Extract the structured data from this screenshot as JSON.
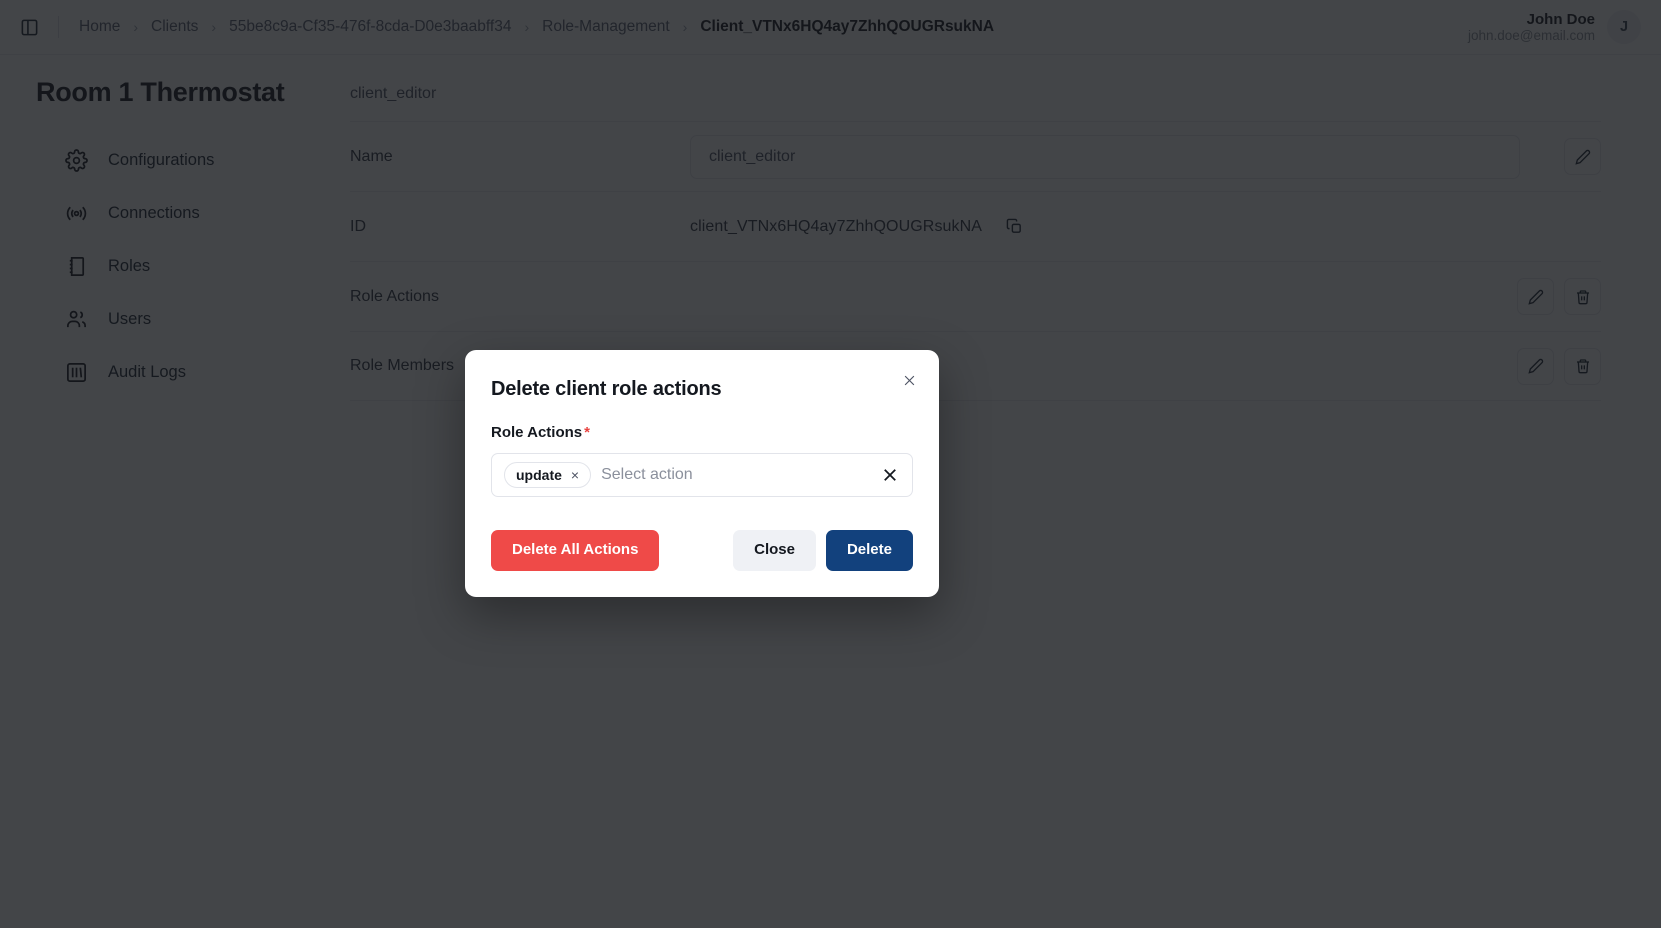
{
  "topbar": {
    "sidebar_toggle_icon": "panel-toggle-icon",
    "breadcrumb": [
      {
        "label": "Home",
        "current": false
      },
      {
        "label": "Clients",
        "current": false
      },
      {
        "label": "55be8c9a-Cf35-476f-8cda-D0e3baabff34",
        "current": false
      },
      {
        "label": "Role-Management",
        "current": false
      },
      {
        "label": "Client_VTNx6HQ4ay7ZhhQOUGRsukNA",
        "current": true
      }
    ],
    "separator": "›",
    "user": {
      "name": "John Doe",
      "email": "john.doe@email.com",
      "avatar_initial": "J"
    }
  },
  "sidebar": {
    "page_title": "Room 1 Thermostat",
    "items": [
      {
        "label": "Configurations",
        "icon": "gear-icon"
      },
      {
        "label": "Connections",
        "icon": "broadcast-icon"
      },
      {
        "label": "Roles",
        "icon": "book-icon"
      },
      {
        "label": "Users",
        "icon": "users-icon"
      },
      {
        "label": "Audit Logs",
        "icon": "logs-icon"
      }
    ]
  },
  "main": {
    "section_heading": "client_editor",
    "rows": [
      {
        "label": "Name",
        "value": "client_editor",
        "value_style": "box",
        "actions": [
          "edit-icon"
        ]
      },
      {
        "label": "ID",
        "value": "client_VTNx6HQ4ay7ZhhQOUGRsukNA",
        "value_style": "plain",
        "actions": [
          "copy-icon"
        ]
      },
      {
        "label": "Role Actions",
        "value": "",
        "value_style": "plain",
        "actions": [
          "edit-icon",
          "trash-icon"
        ]
      },
      {
        "label": "Role Members",
        "value": "",
        "value_style": "plain",
        "actions": [
          "edit-icon",
          "trash-icon"
        ]
      }
    ]
  },
  "modal": {
    "title": "Delete client role actions",
    "close_icon": "close-icon",
    "field": {
      "label": "Role Actions",
      "required_marker": "*",
      "chips": [
        {
          "label": "update",
          "remove_icon": "×"
        }
      ],
      "placeholder": "Select action",
      "clear_icon": "clear-all-icon"
    },
    "buttons": {
      "delete_all": "Delete All Actions",
      "close": "Close",
      "delete": "Delete"
    }
  },
  "colors": {
    "danger": "#ef4a48",
    "primary": "#12417d",
    "neutral": "#eff1f5",
    "required": "#e8423f",
    "overlay": "rgba(20,22,26,0.80)"
  }
}
